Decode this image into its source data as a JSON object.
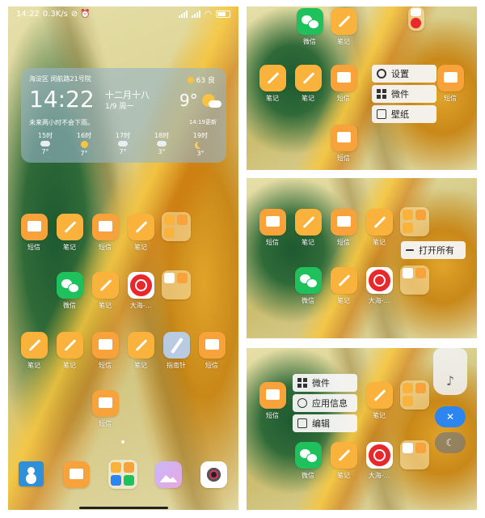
{
  "status": {
    "time": "14:22",
    "speed": "0.3K/s"
  },
  "weather": {
    "location": "海淀区 闵航路21号院",
    "aqi": "63 良",
    "time": "14:22",
    "lunar": "十二月十八",
    "date": "1/9 周一",
    "temp": "9°",
    "desc": "未来两小时不会下雨。",
    "updated": "14:19更新",
    "hours": [
      {
        "time": "15时",
        "icon": "partly-cloudy-icon",
        "temp": "7°"
      },
      {
        "time": "16时",
        "icon": "sun-icon",
        "temp": "7°"
      },
      {
        "time": "17时",
        "icon": "cloud-icon",
        "temp": "7°"
      },
      {
        "time": "18时",
        "icon": "cloud-icon",
        "temp": "3°"
      },
      {
        "time": "19时",
        "icon": "moon-icon",
        "temp": "3°"
      }
    ]
  },
  "apps": {
    "sms": "短信",
    "notes": "笔记",
    "wechat": "微信",
    "music": "大海-...",
    "compass": "指南针"
  },
  "menus": {
    "settings": "设置",
    "widgets": "微件",
    "wallpaper": "壁纸",
    "open_all": "打开所有",
    "app_info": "应用信息",
    "edit": "编辑"
  },
  "colors": {
    "accent": "#2d86f0",
    "sms": "#f7a23b",
    "wechat": "#1fc15c",
    "music": "#e8282c"
  }
}
